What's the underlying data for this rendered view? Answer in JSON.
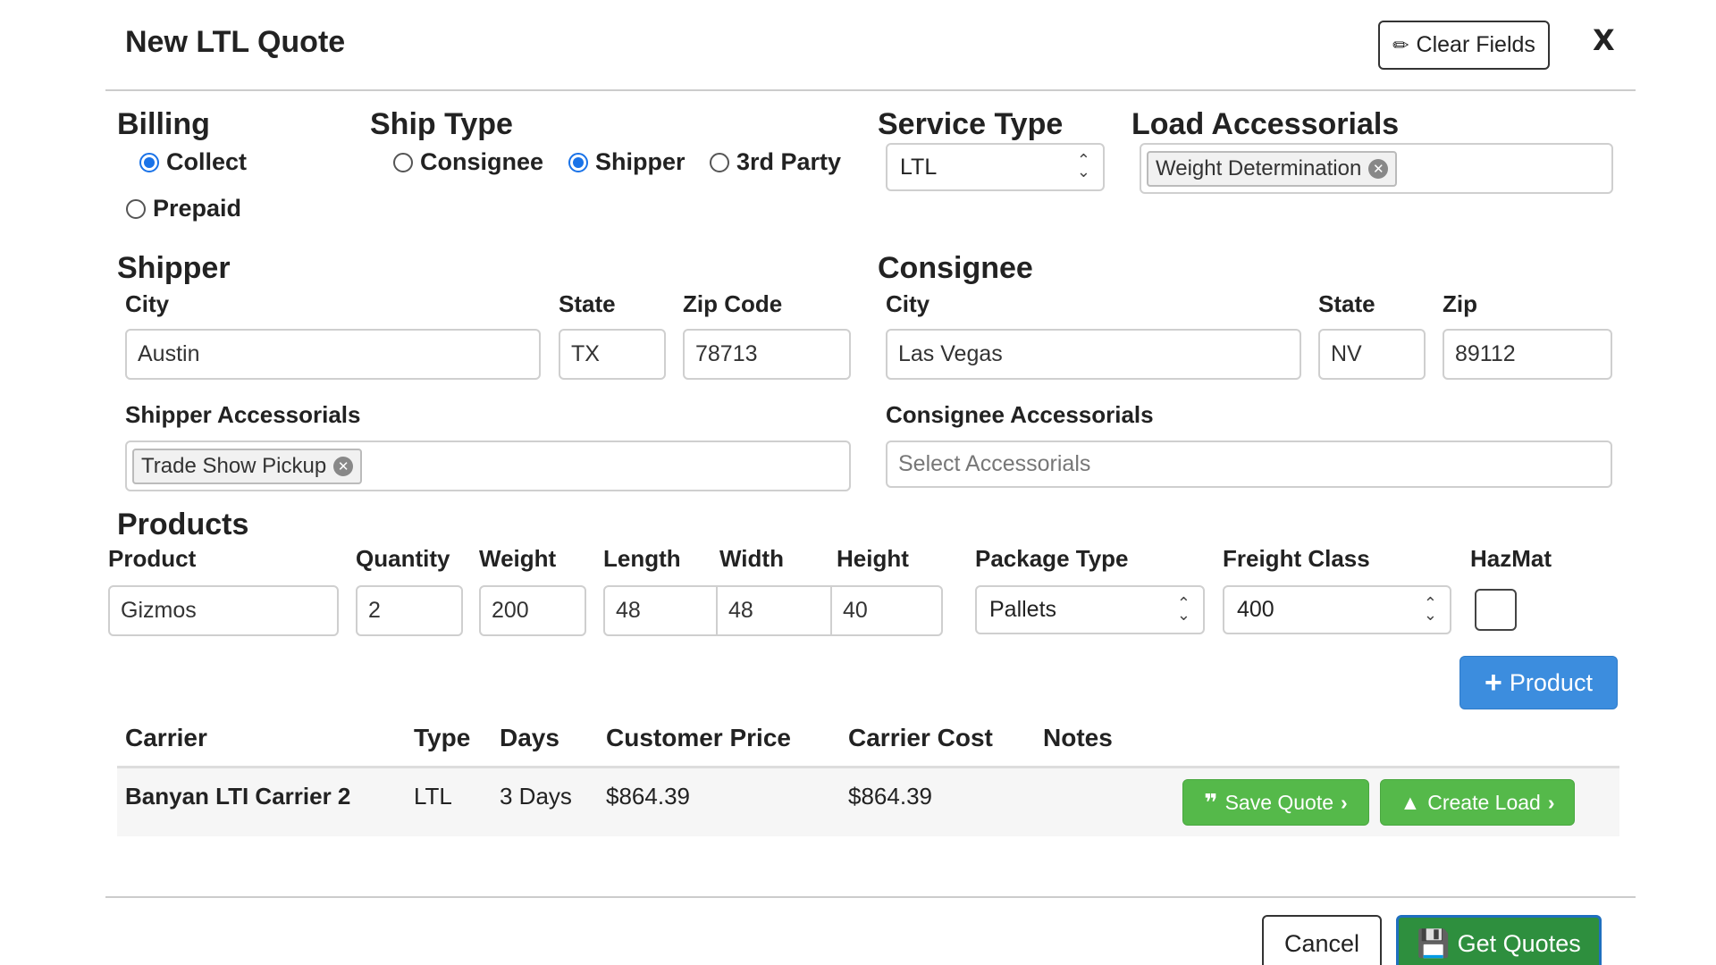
{
  "header": {
    "title": "New LTL Quote",
    "clear_label": "Clear Fields",
    "close_label": "X"
  },
  "billing": {
    "heading": "Billing",
    "options": [
      "Collect",
      "Prepaid"
    ],
    "selected": "Collect"
  },
  "ship_type": {
    "heading": "Ship Type",
    "options": [
      "Consignee",
      "Shipper",
      "3rd Party"
    ],
    "selected": "Shipper"
  },
  "service_type": {
    "heading": "Service Type",
    "value": "LTL"
  },
  "load_accessorials": {
    "heading": "Load Accessorials",
    "tags": [
      "Weight Determination"
    ]
  },
  "shipper": {
    "heading": "Shipper",
    "city_label": "City",
    "state_label": "State",
    "zip_label": "Zip Code",
    "city": "Austin",
    "state": "TX",
    "zip": "78713",
    "accessorials_label": "Shipper Accessorials",
    "accessorials": [
      "Trade Show Pickup"
    ]
  },
  "consignee": {
    "heading": "Consignee",
    "city_label": "City",
    "state_label": "State",
    "zip_label": "Zip",
    "city": "Las Vegas",
    "state": "NV",
    "zip": "89112",
    "accessorials_label": "Consignee Accessorials",
    "accessorials_placeholder": "Select Accessorials"
  },
  "products": {
    "heading": "Products",
    "labels": {
      "product": "Product",
      "quantity": "Quantity",
      "weight": "Weight",
      "length": "Length",
      "width": "Width",
      "height": "Height",
      "package_type": "Package Type",
      "freight_class": "Freight Class",
      "hazmat": "HazMat"
    },
    "row": {
      "product": "Gizmos",
      "quantity": "2",
      "weight": "200",
      "length": "48",
      "width": "48",
      "height": "40",
      "package_type": "Pallets",
      "freight_class": "400",
      "hazmat": false
    },
    "add_label": "Product"
  },
  "results": {
    "headers": {
      "carrier": "Carrier",
      "type": "Type",
      "days": "Days",
      "customer_price": "Customer Price",
      "carrier_cost": "Carrier Cost",
      "notes": "Notes"
    },
    "rows": [
      {
        "carrier": "Banyan LTI Carrier 2",
        "type": "LTL",
        "days": "3 Days",
        "customer_price": "$864.39",
        "carrier_cost": "$864.39",
        "notes": ""
      }
    ],
    "save_label": "Save Quote",
    "create_label": "Create Load"
  },
  "footer": {
    "cancel_label": "Cancel",
    "get_quotes_label": "Get Quotes"
  },
  "colors": {
    "primary_blue": "#3c8dde",
    "success_green": "#55b94a",
    "dark_green": "#2e8f3e",
    "radio_blue": "#1a73e8"
  }
}
